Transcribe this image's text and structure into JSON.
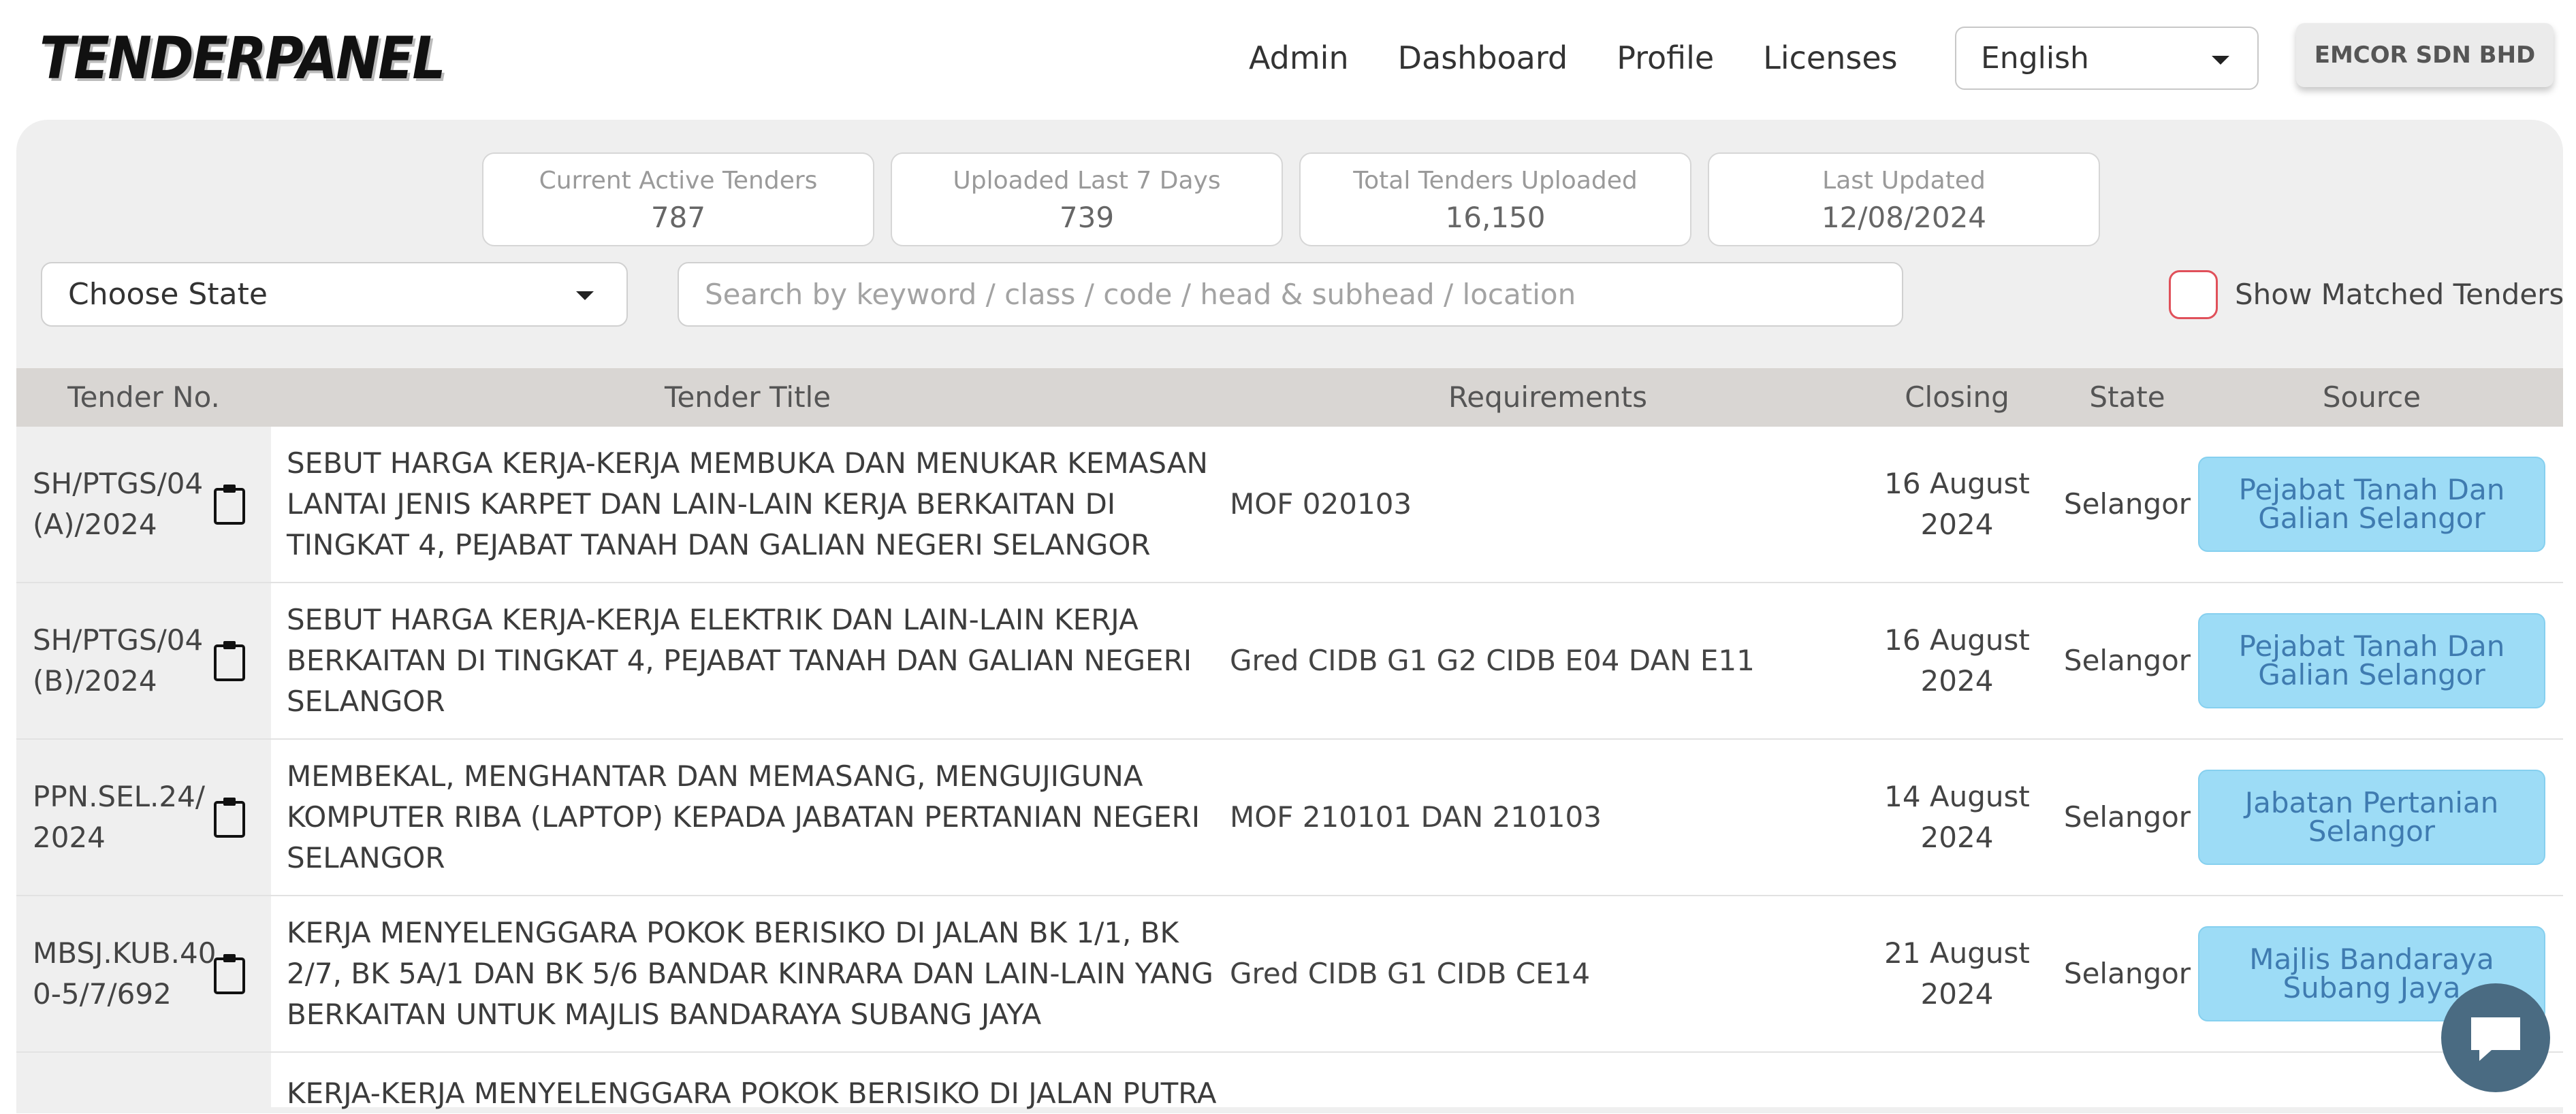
{
  "header": {
    "logo": "TENDERPANEL",
    "nav": [
      "Admin",
      "Dashboard",
      "Profile",
      "Licenses"
    ],
    "language": "English",
    "company": "EMCOR SDN BHD"
  },
  "stats": [
    {
      "label": "Current Active Tenders",
      "value": "787"
    },
    {
      "label": "Uploaded Last 7 Days",
      "value": "739"
    },
    {
      "label": "Total Tenders Uploaded",
      "value": "16,150"
    },
    {
      "label": "Last Updated",
      "value": "12/08/2024"
    }
  ],
  "filters": {
    "state_placeholder": "Choose State",
    "search_placeholder": "Search by keyword / class / code / head & subhead / location",
    "show_matched_label": "Show Matched Tenders"
  },
  "table": {
    "headers": [
      "Tender No.",
      "Tender Title",
      "Requirements",
      "Closing",
      "State",
      "Source"
    ],
    "rows": [
      {
        "no": "SH/PTGS/04 (A)/2024",
        "title": "SEBUT HARGA KERJA-KERJA MEMBUKA DAN MENUKAR KEMASAN LANTAI JENIS KARPET DAN LAIN-LAIN KERJA BERKAITAN DI TINGKAT 4, PEJABAT TANAH DAN GALIAN NEGERI SELANGOR",
        "requirements": "MOF 020103",
        "closing": "16 August 2024",
        "state": "Selangor",
        "source": "Pejabat Tanah Dan Galian Selangor"
      },
      {
        "no": "SH/PTGS/04 (B)/2024",
        "title": "SEBUT HARGA KERJA-KERJA ELEKTRIK DAN LAIN-LAIN KERJA BERKAITAN DI TINGKAT 4, PEJABAT TANAH DAN GALIAN NEGERI SELANGOR",
        "requirements": "Gred CIDB G1 G2 CIDB E04 DAN E11",
        "closing": "16 August 2024",
        "state": "Selangor",
        "source": "Pejabat Tanah Dan Galian Selangor"
      },
      {
        "no": "PPN.SEL.24/ 2024",
        "title": "MEMBEKAL, MENGHANTAR DAN MEMASANG, MENGUJIGUNA KOMPUTER RIBA (LAPTOP) KEPADA JABATAN PERTANIAN NEGERI SELANGOR",
        "requirements": "MOF 210101 DAN 210103",
        "closing": "14 August 2024",
        "state": "Selangor",
        "source": "Jabatan Pertanian Selangor"
      },
      {
        "no": "MBSJ.KUB.40 0-5/7/692",
        "title": "KERJA MENYELENGGARA POKOK BERISIKO DI JALAN BK 1/1, BK 2/7, BK 5A/1 DAN BK 5/6 BANDAR KINRARA DAN LAIN-LAIN YANG BERKAITAN UNTUK MAJLIS BANDARAYA SUBANG JAYA",
        "requirements": "Gred CIDB G1 CIDB CE14",
        "closing": "21 August 2024",
        "state": "Selangor",
        "source": "Majlis Bandaraya Subang Jaya"
      },
      {
        "no": "",
        "title": "KERJA-KERJA MENYELENGGARA POKOK BERISIKO DI JALAN PUTRA",
        "requirements": "",
        "closing": "",
        "state": "",
        "source": ""
      }
    ]
  },
  "icons": {
    "clipboard": "clipboard-icon",
    "dropdown": "chevron-down-icon",
    "chat": "chat-icon"
  },
  "colors": {
    "source_badge": "#9ddcf6",
    "checkbox_border": "#e0505a",
    "header_bg": "#d9d6d3"
  }
}
